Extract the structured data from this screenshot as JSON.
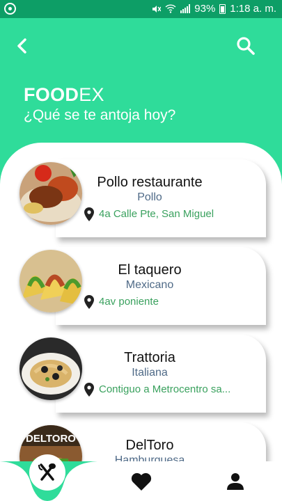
{
  "status_bar": {
    "battery": "93%",
    "time": "1:18 a. m."
  },
  "header": {
    "brand_bold": "FOOD",
    "brand_light": "EX",
    "tagline": "¿Qué se te antoja hoy?"
  },
  "restaurants": [
    {
      "name": "Pollo restaurante",
      "category": "Pollo",
      "address": "4a Calle Pte, San Miguel"
    },
    {
      "name": "El taquero",
      "category": "Mexicano",
      "address": "4av poniente"
    },
    {
      "name": "Trattoria",
      "category": "Italiana",
      "address": "Contiguo a Metrocentro sa..."
    },
    {
      "name": "DelToro",
      "category": "Hamburguesa",
      "address": ""
    }
  ],
  "logo_text": "DELTORO",
  "colors": {
    "accent": "#2fdc9a",
    "status_bar": "#0d9e66",
    "address": "#3aa15e",
    "category": "#4f6a87"
  },
  "icons": {
    "back": "chevron-left-icon",
    "search": "search-icon",
    "pin": "map-pin-icon",
    "home": "fork-knife-icon",
    "favorites": "heart-icon",
    "profile": "user-icon"
  }
}
